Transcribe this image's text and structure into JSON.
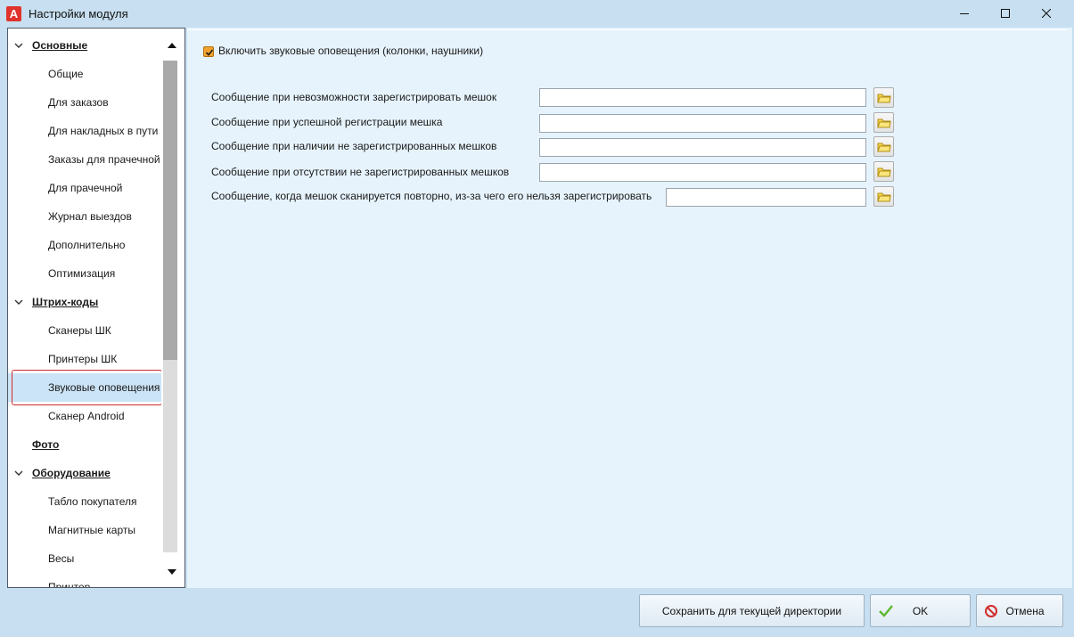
{
  "window": {
    "title": "Настройки модуля",
    "logo_letter": "A",
    "minimize_icon": "minimize-icon",
    "maximize_icon": "maximize-icon",
    "close_icon": "close-icon"
  },
  "tree": {
    "items": [
      {
        "type": "group",
        "label": "Основные",
        "expanded": true
      },
      {
        "type": "item",
        "label": "Общие"
      },
      {
        "type": "item",
        "label": "Для заказов"
      },
      {
        "type": "item",
        "label": "Для накладных в пути"
      },
      {
        "type": "item",
        "label": "Заказы для прачечной"
      },
      {
        "type": "item",
        "label": "Для прачечной"
      },
      {
        "type": "item",
        "label": "Журнал выездов"
      },
      {
        "type": "item",
        "label": "Дополнительно"
      },
      {
        "type": "item",
        "label": "Оптимизация"
      },
      {
        "type": "group",
        "label": "Штрих-коды",
        "expanded": true
      },
      {
        "type": "item",
        "label": "Сканеры ШК"
      },
      {
        "type": "item",
        "label": "Принтеры ШК"
      },
      {
        "type": "item",
        "label": "Звуковые оповещения",
        "selected": true
      },
      {
        "type": "item",
        "label": "Сканер Android"
      },
      {
        "type": "group",
        "label": "Фото",
        "expanded": false
      },
      {
        "type": "group",
        "label": "Оборудование",
        "expanded": true
      },
      {
        "type": "item",
        "label": "Табло покупателя"
      },
      {
        "type": "item",
        "label": "Магнитные карты"
      },
      {
        "type": "item",
        "label": "Весы"
      },
      {
        "type": "item",
        "label": "Принтер"
      }
    ]
  },
  "content": {
    "enable_sound": {
      "label": "Включить звуковые оповещения (колонки, наушники)",
      "checked": true
    },
    "messages": [
      {
        "label": "Сообщение при невозможности зарегистрировать мешок",
        "value": ""
      },
      {
        "label": "Сообщение при успешной регистрации мешка",
        "value": ""
      },
      {
        "label": "Сообщение при наличии не зарегистрированных мешков",
        "value": ""
      },
      {
        "label": "Сообщение при отсутствии не зарегистрированных мешков",
        "value": ""
      },
      {
        "label": "Сообщение, когда мешок сканируется повторно, из-за чего его нельзя зарегистрировать",
        "value": ""
      }
    ],
    "browse_icon": "folder-icon"
  },
  "buttons": {
    "save_dir": "Сохранить для текущей директории",
    "ok": "OK",
    "cancel": "Отмена"
  },
  "colors": {
    "accent_check": "#f3a32d",
    "ok_check": "#5cb82e",
    "cancel_icon": "#d22b2b",
    "selection_outline": "#cc2b2b"
  }
}
